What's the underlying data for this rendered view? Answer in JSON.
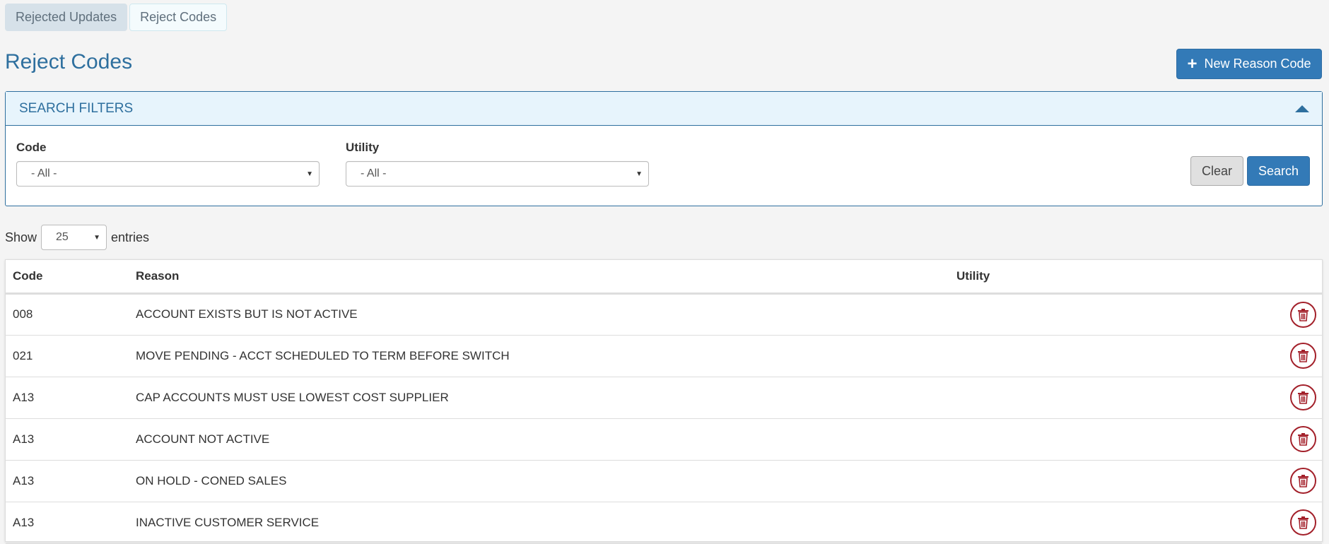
{
  "tabs": [
    {
      "label": "Rejected Updates"
    },
    {
      "label": "Reject Codes"
    }
  ],
  "page_title": "Reject Codes",
  "new_button_label": "New Reason Code",
  "filters": {
    "title": "SEARCH FILTERS",
    "code_label": "Code",
    "code_value": "- All -",
    "utility_label": "Utility",
    "utility_value": "- All -",
    "clear_label": "Clear",
    "search_label": "Search"
  },
  "length": {
    "prefix": "Show",
    "value": "25",
    "suffix": "entries"
  },
  "table": {
    "columns": [
      "Code",
      "Reason",
      "Utility"
    ],
    "rows": [
      {
        "code": "008",
        "reason": "ACCOUNT EXISTS BUT IS NOT ACTIVE",
        "utility": ""
      },
      {
        "code": "021",
        "reason": "MOVE PENDING - ACCT SCHEDULED TO TERM BEFORE SWITCH",
        "utility": ""
      },
      {
        "code": "A13",
        "reason": "CAP ACCOUNTS MUST USE LOWEST COST SUPPLIER",
        "utility": ""
      },
      {
        "code": "A13",
        "reason": "ACCOUNT NOT ACTIVE",
        "utility": ""
      },
      {
        "code": "A13",
        "reason": "ON HOLD - CONED SALES",
        "utility": ""
      },
      {
        "code": "A13",
        "reason": "INACTIVE CUSTOMER SERVICE",
        "utility": ""
      }
    ]
  },
  "colors": {
    "primary": "#337ab7",
    "title": "#2e6f9e",
    "danger": "#a3202a"
  },
  "icons": {
    "new": "plus-icon",
    "collapse": "caret-up-icon",
    "delete": "trash-icon"
  }
}
